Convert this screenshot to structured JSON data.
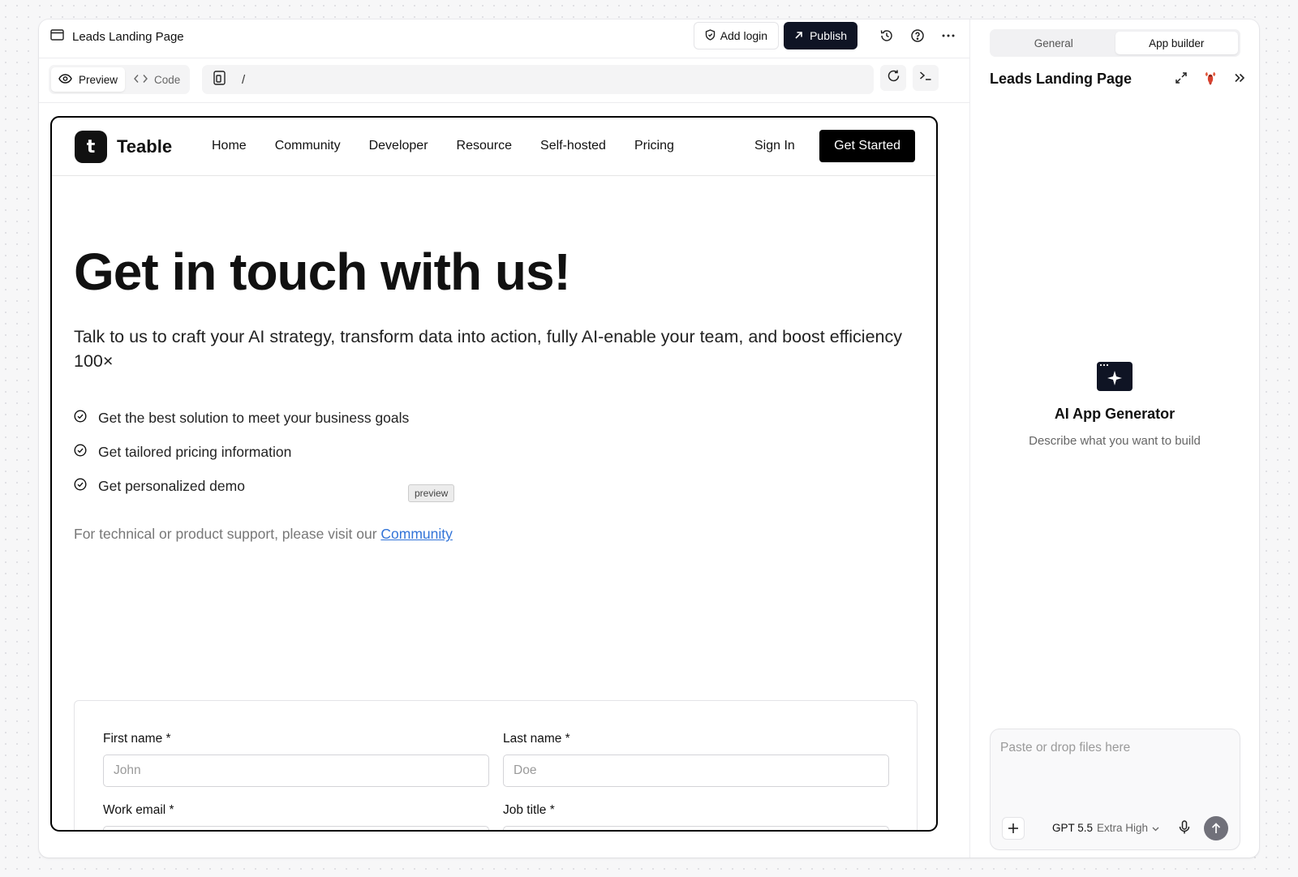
{
  "app": {
    "page_title": "Leads Landing Page",
    "add_login_label": "Add login",
    "publish_label": "Publish"
  },
  "toolbar": {
    "preview_label": "Preview",
    "code_label": "Code",
    "route": "/"
  },
  "site": {
    "logo_text": "Teable",
    "logo_mark": "t",
    "nav": [
      "Home",
      "Community",
      "Developer",
      "Resource",
      "Self-hosted",
      "Pricing"
    ],
    "sign_in": "Sign In",
    "get_started": "Get Started",
    "hero_title": "Get in touch with us!",
    "hero_subtitle": "Talk to us to craft your AI strategy, transform data into action, fully AI-enable your team, and boost efficiency 100×",
    "bullets": [
      "Get the best solution to meet your business goals",
      "Get tailored pricing information",
      "Get personalized demo"
    ],
    "support_text": "For technical or product support, please visit our ",
    "support_link": "Community",
    "preview_tag": "preview",
    "form": {
      "first_name_label": "First name *",
      "first_name_placeholder": "John",
      "last_name_label": "Last name *",
      "last_name_placeholder": "Doe",
      "work_email_label": "Work email *",
      "job_title_label": "Job title *"
    }
  },
  "panel": {
    "tab_general": "General",
    "tab_app_builder": "App builder",
    "title": "Leads Landing Page",
    "ai_title": "AI App Generator",
    "ai_desc": "Describe what you want to build",
    "composer_placeholder": "Paste or drop files here",
    "model_name": "GPT 5.5",
    "model_effort": "Extra High"
  },
  "icons": {
    "window": "window-icon",
    "shield": "shield-icon",
    "publish_arrow": "arrow-up-right-icon",
    "history": "history-icon",
    "help": "help-icon",
    "more": "more-icon",
    "eye": "eye-icon",
    "code": "code-icon",
    "device": "device-icon",
    "refresh": "refresh-icon",
    "terminal": "terminal-icon",
    "expand": "expand-icon",
    "lobster": "lobster-icon",
    "collapse": "chevrons-right-icon",
    "check": "check-circle-icon",
    "plus": "plus-icon",
    "mic": "mic-icon",
    "send": "send-icon"
  },
  "colors": {
    "accent_dark": "#0f1424",
    "link": "#3274d8"
  }
}
